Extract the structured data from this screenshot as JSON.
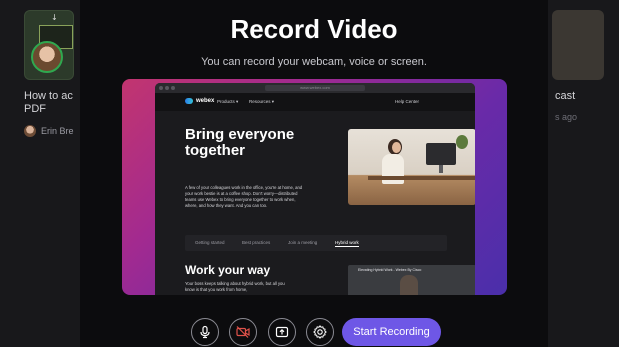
{
  "background": {
    "left_card": {
      "title": "How to ac… PDF",
      "title_line1": "How to ac",
      "title_line2": "PDF",
      "author": "Erin Bre"
    },
    "right_card": {
      "title": "cast",
      "meta": "s ago"
    }
  },
  "modal": {
    "title": "Record Video",
    "subtitle": "You can record your webcam, voice or screen."
  },
  "preview": {
    "browser_url": "www.webex.com",
    "site": {
      "logo": "webex",
      "nav_products": "Products ▾",
      "nav_resources": "Resources ▾",
      "nav_help": "Help Center",
      "hero_title": "Bring everyone together",
      "hero_text": "A few of your colleagues work in the office, you're at home, and your work bestie is at a coffee shop. Don't worry—distributed teams use Webex to bring everyone together to work when, where, and how they want. And you can too.",
      "tabs": [
        "Getting started",
        "Best practices",
        "Join a meeting",
        "Hybrid work"
      ],
      "active_tab": "Hybrid work",
      "section_title": "Work your way",
      "section_text": "Your boss keeps talking about hybrid work, but all you know is that you work from home,",
      "video_title": "Elevating Hybrid Work - Webex By Cisco"
    }
  },
  "controls": {
    "record_label": "Start Recording",
    "icons": [
      "microphone-icon",
      "camera-off-icon",
      "screen-share-icon",
      "settings-icon"
    ],
    "accent_color": "#6e57e6",
    "camera_off_color": "#e0524a"
  }
}
